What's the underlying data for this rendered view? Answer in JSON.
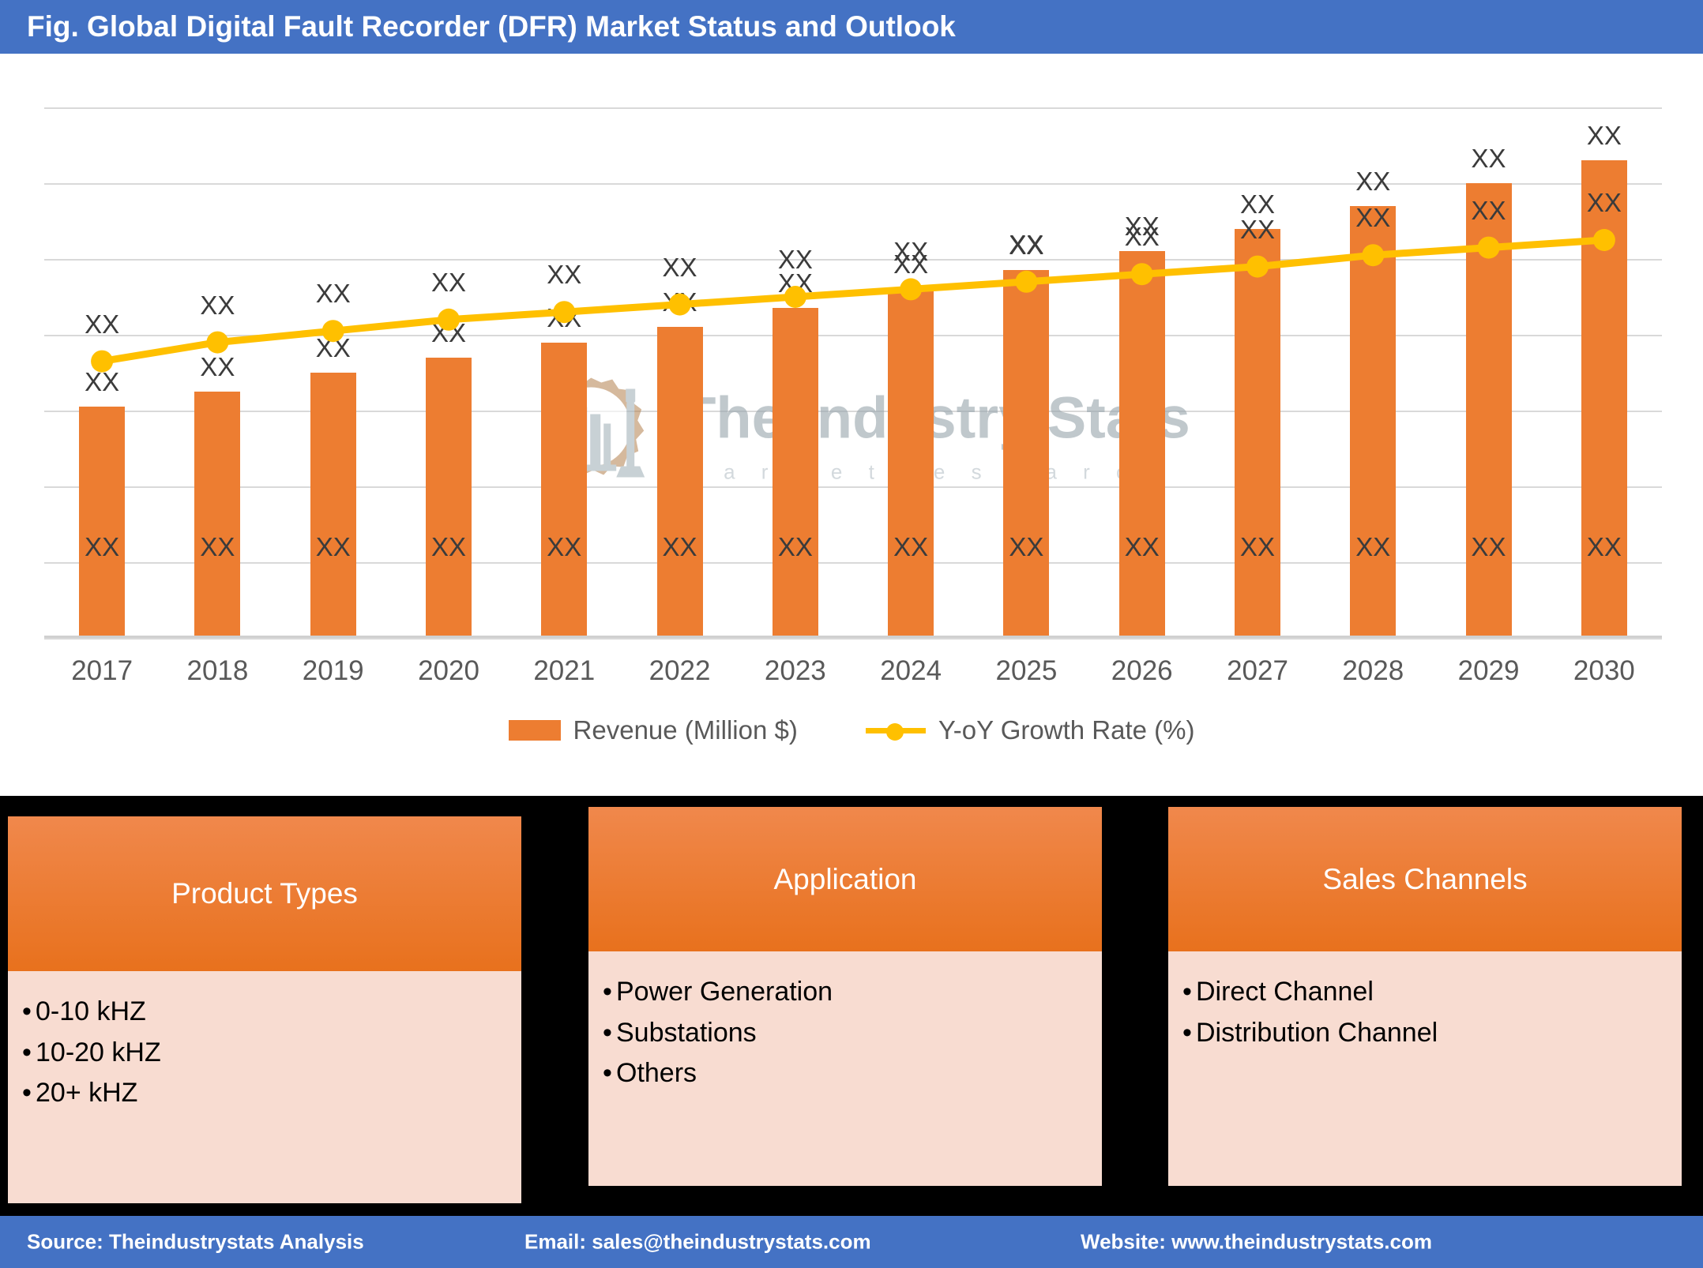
{
  "header": {
    "title": "Fig. Global Digital Fault Recorder (DFR) Market Status and Outlook",
    "bg_color": "#4472C4",
    "text_color": "#FFFFFF"
  },
  "watermark": {
    "main": "The Industry Stats",
    "sub": "m a r k e t    r e s e a r c h",
    "logo_icon": "gear-building-wrench-icon"
  },
  "chart_data": {
    "type": "bar",
    "title": "Fig. Global Digital Fault Recorder (DFR) Market Status and Outlook",
    "xlabel": "",
    "ylabel": "",
    "grid": true,
    "legend_position": "bottom",
    "categories": [
      "2017",
      "2018",
      "2019",
      "2020",
      "2021",
      "2022",
      "2023",
      "2024",
      "2025",
      "2026",
      "2027",
      "2028",
      "2029",
      "2030"
    ],
    "series": [
      {
        "name": "Revenue (Million $)",
        "type": "bar",
        "color": "#ED7D31",
        "values": [
          61,
          65,
          70,
          74,
          78,
          82,
          87,
          92,
          97,
          102,
          108,
          114,
          120,
          126
        ],
        "value_labels": [
          "XX",
          "XX",
          "XX",
          "XX",
          "XX",
          "XX",
          "XX",
          "XX",
          "XX",
          "XX",
          "XX",
          "XX",
          "XX",
          "XX"
        ],
        "top_labels": [
          "XX",
          "XX",
          "XX",
          "XX",
          "XX",
          "XX",
          "XX",
          "XX",
          "XX",
          "XX",
          "XX",
          "XX",
          "XX",
          "XX"
        ]
      },
      {
        "name": "Y-oY Growth Rate (%)",
        "type": "line",
        "color": "#FFC000",
        "values": [
          73,
          78,
          81,
          84,
          86,
          88,
          90,
          92,
          94,
          96,
          98,
          101,
          103,
          105
        ],
        "point_labels": [
          "XX",
          "XX",
          "XX",
          "XX",
          "XX",
          "XX",
          "XX",
          "XX",
          "XX",
          "XX",
          "XX",
          "XX",
          "XX",
          "XX"
        ]
      }
    ],
    "ylim": [
      0,
      140
    ],
    "gridline_count": 8
  },
  "legend": {
    "items": [
      {
        "label": "Revenue (Million $)",
        "icon": "bar-swatch-icon",
        "color": "#ED7D31"
      },
      {
        "label": "Y-oY Growth Rate (%)",
        "icon": "line-marker-icon",
        "color": "#FFC000"
      }
    ]
  },
  "panels": [
    {
      "id": "product",
      "title": "Product Types",
      "items": [
        "0-10 kHZ",
        "10-20 kHZ",
        "20+ kHZ"
      ],
      "header_color": "#E8711D",
      "body_color": "#F8DCD1"
    },
    {
      "id": "application",
      "title": "Application",
      "items": [
        "Power Generation",
        "Substations",
        "Others"
      ],
      "header_color": "#E8711D",
      "body_color": "#F8DCD1"
    },
    {
      "id": "sales",
      "title": "Sales Channels",
      "items": [
        "Direct Channel",
        "Distribution Channel"
      ],
      "header_color": "#E8711D",
      "body_color": "#F8DCD1"
    }
  ],
  "footer": {
    "source": "Source: Theindustrystats Analysis",
    "email": "Email: sales@theindustrystats.com",
    "website": "Website: www.theindustrystats.com",
    "bg_color": "#4472C4"
  }
}
